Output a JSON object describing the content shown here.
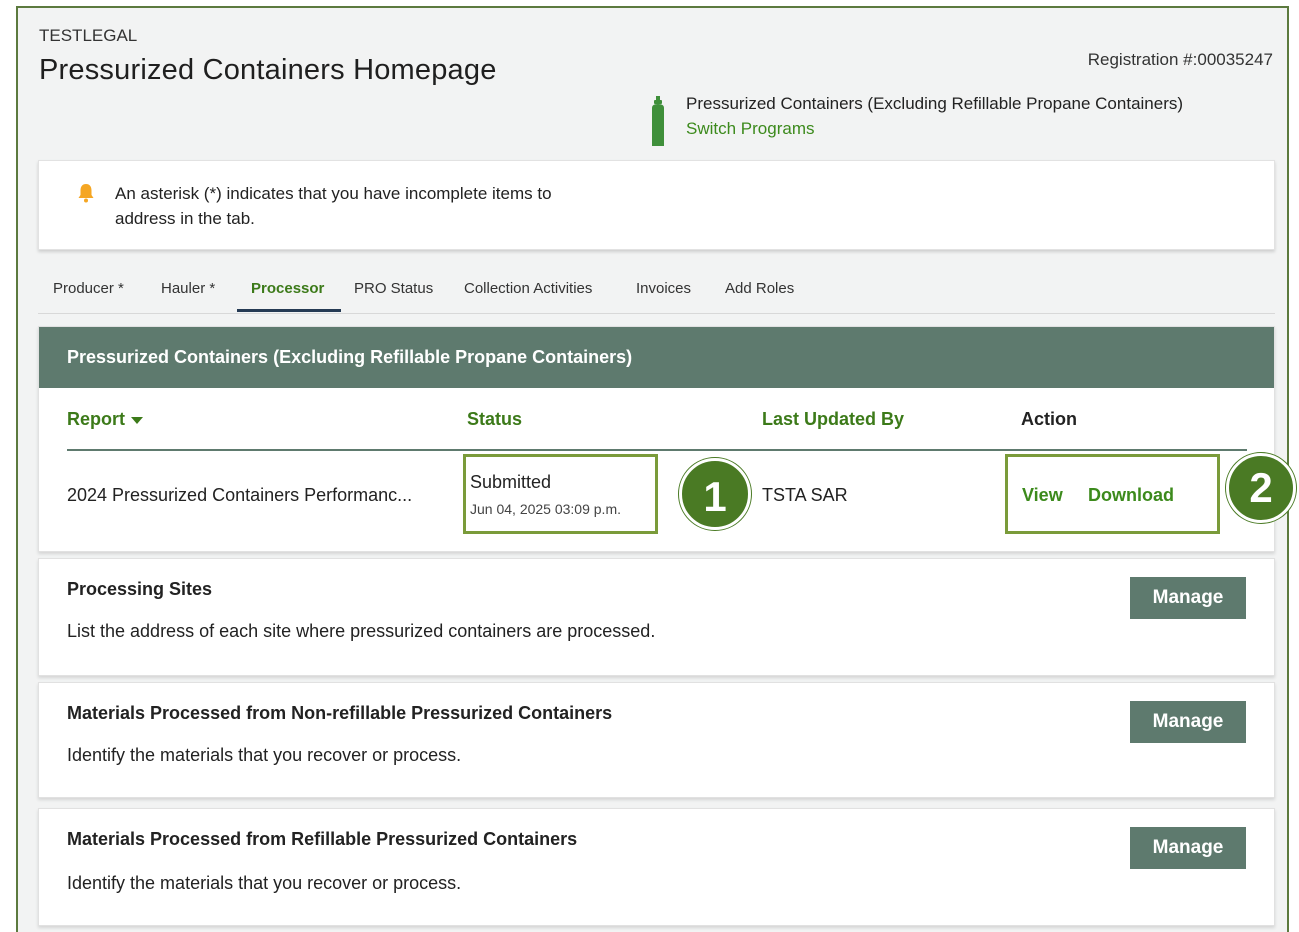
{
  "header": {
    "org": "TESTLEGAL",
    "title": "Pressurized Containers Homepage",
    "registration": "Registration #:00035247",
    "program_name": "Pressurized Containers (Excluding Refillable Propane Containers)",
    "switch_programs": "Switch Programs",
    "program_icon": "gas-cylinder-icon"
  },
  "alert": {
    "icon": "bell-icon",
    "text": "An asterisk (*) indicates that you have incomplete items to address in the tab."
  },
  "tabs": [
    {
      "label": "Producer *"
    },
    {
      "label": "Hauler *"
    },
    {
      "label": "Processor",
      "active": true
    },
    {
      "label": "PRO Status"
    },
    {
      "label": "Collection Activities"
    },
    {
      "label": "Invoices"
    },
    {
      "label": "Add Roles"
    }
  ],
  "reports_card": {
    "title": "Pressurized Containers (Excluding Refillable Propane Containers)",
    "columns": {
      "report": "Report",
      "status": "Status",
      "last_updated_by": "Last Updated By",
      "action": "Action"
    },
    "rows": [
      {
        "report": "2024 Pressurized Containers Performanc...",
        "status": "Submitted",
        "status_date": "Jun 04, 2025 03:09 p.m.",
        "last_updated_by": "TSTA SAR",
        "view": "View",
        "download": "Download"
      }
    ],
    "callouts": [
      "1",
      "2"
    ]
  },
  "sections": [
    {
      "title": "Processing Sites",
      "description": "List the address of each site where pressurized containers are processed.",
      "button": "Manage"
    },
    {
      "title": "Materials Processed from Non-refillable Pressurized Containers",
      "description": "Identify the materials that you recover or process.",
      "button": "Manage"
    },
    {
      "title": "Materials Processed from Refillable Pressurized Containers",
      "description": "Identify the materials that you recover or process.",
      "button": "Manage"
    }
  ],
  "colors": {
    "accent_green": "#3c8a1c",
    "header_slate": "#5e7a6e",
    "callout_green": "#4a7a24",
    "highlight_border": "#7a9b3a",
    "bell": "#f5a623"
  }
}
